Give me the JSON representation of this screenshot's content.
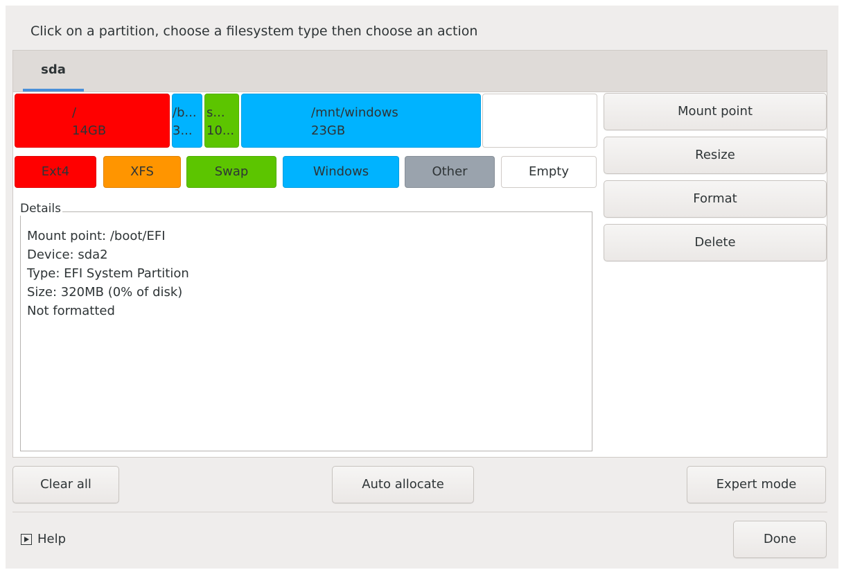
{
  "instruction": "Click on a partition, choose a filesystem type then choose an action",
  "tabs": [
    {
      "label": "sda"
    }
  ],
  "partitions": [
    {
      "line1": "/",
      "line2": "14GB",
      "color": "#ff0000"
    },
    {
      "line1": "/b...",
      "line2": "3...",
      "color": "#00b3ff"
    },
    {
      "line1": "s...",
      "line2": "10...",
      "color": "#5cc500"
    },
    {
      "line1": "/mnt/windows",
      "line2": "23GB",
      "color": "#00b3ff"
    },
    {
      "line1": "",
      "line2": "",
      "color": "#ffffff"
    }
  ],
  "legend": [
    {
      "label": "Ext4",
      "color": "#ff0000"
    },
    {
      "label": "XFS",
      "color": "#ff9500"
    },
    {
      "label": "Swap",
      "color": "#5cc500"
    },
    {
      "label": "Windows",
      "color": "#00b3ff"
    },
    {
      "label": "Other",
      "color": "#9aa3ad"
    },
    {
      "label": "Empty",
      "color": "#ffffff"
    }
  ],
  "details": {
    "label": "Details",
    "lines": [
      "Mount point: /boot/EFI",
      "Device: sda2",
      "Type: EFI System Partition",
      "Size: 320MB (0% of disk)",
      "Not formatted"
    ]
  },
  "actions": {
    "mount_point": "Mount point",
    "resize": "Resize",
    "format": "Format",
    "delete": "Delete"
  },
  "bottom": {
    "clear_all": "Clear all",
    "auto_allocate": "Auto allocate",
    "expert_mode": "Expert mode"
  },
  "footer": {
    "help": "Help",
    "done": "Done"
  }
}
